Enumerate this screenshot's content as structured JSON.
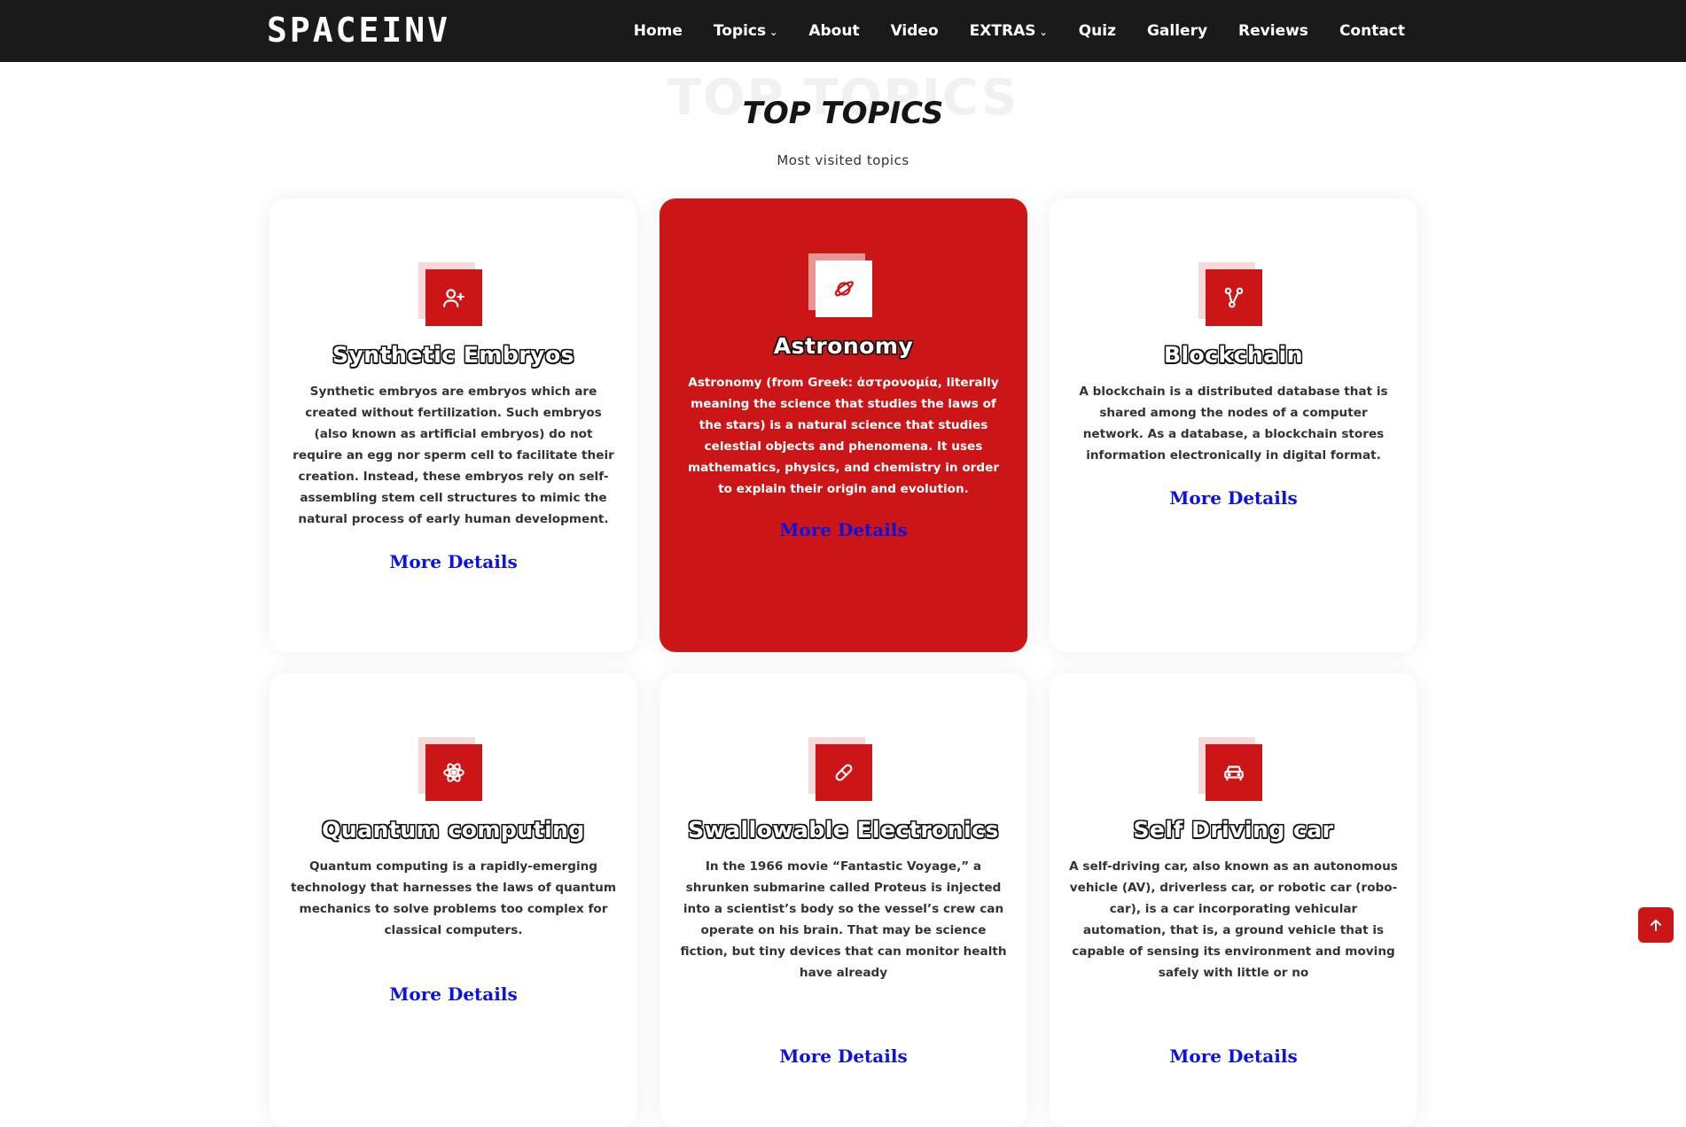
{
  "brand": {
    "logo": "SPACEINV"
  },
  "nav": {
    "items": [
      {
        "label": "Home",
        "dropdown": false
      },
      {
        "label": "Topics",
        "dropdown": true
      },
      {
        "label": "About",
        "dropdown": false
      },
      {
        "label": "Video",
        "dropdown": false
      },
      {
        "label": "EXTRAS",
        "dropdown": true
      },
      {
        "label": "Quiz",
        "dropdown": false
      },
      {
        "label": "Gallery",
        "dropdown": false
      },
      {
        "label": "Reviews",
        "dropdown": false
      },
      {
        "label": "Contact",
        "dropdown": false
      }
    ]
  },
  "section": {
    "bg_title": "TOP TOPICS",
    "title": "TOP TOPICS",
    "subtitle": "Most visited topics"
  },
  "cards": [
    {
      "icon": "user-plus-icon",
      "title": "Synthetic Embryos",
      "description": "Synthetic embryos are embryos which are created without fertilization. Such embryos (also known as artificial embryos) do not require an egg nor sperm cell to facilitate their creation. Instead, these embryos rely on self-assembling stem cell structures to mimic the natural process of early human development.",
      "link": "More Details"
    },
    {
      "icon": "planet-icon",
      "title": "Astronomy",
      "description": "Astronomy (from Greek: ἀστρονομία, literally meaning the science that studies the laws of the stars) is a natural science that studies celestial objects and phenomena. It uses mathematics, physics, and chemistry in order to explain their origin and evolution.",
      "link": "More Details"
    },
    {
      "icon": "nodes-icon",
      "title": "Blockchain",
      "description": "A blockchain is a distributed database that is shared among the nodes of a computer network. As a database, a blockchain stores information electronically in digital format.",
      "link": "More Details"
    },
    {
      "icon": "atom-icon",
      "title": "Quantum computing",
      "description": "Quantum computing is a rapidly-emerging technology that harnesses the laws of quantum mechanics to solve problems too complex for classical computers.",
      "link": "More Details"
    },
    {
      "icon": "capsule-icon",
      "title": "Swallowable Electronics",
      "description": "In the 1966 movie “Fantastic Voyage,” a shrunken submarine called Proteus is injected into a scientist’s body so the vessel’s crew can operate on his brain. That may be science fiction, but tiny devices that can monitor health have already",
      "link": "More Details"
    },
    {
      "icon": "car-icon",
      "title": "Self Driving car",
      "description": "A self-driving car, also known as an autonomous vehicle (AV), driverless car, or robotic car (robo-car), is a car incorporating vehicular automation, that is, a ground vehicle that is capable of sensing its environment and moving safely with little or no",
      "link": "More Details"
    }
  ],
  "colors": {
    "accent": "#cc1516",
    "header_bg": "#1a1a1a",
    "link": "#0b12e6"
  },
  "scroll_top": {
    "icon": "arrow-up-icon"
  }
}
